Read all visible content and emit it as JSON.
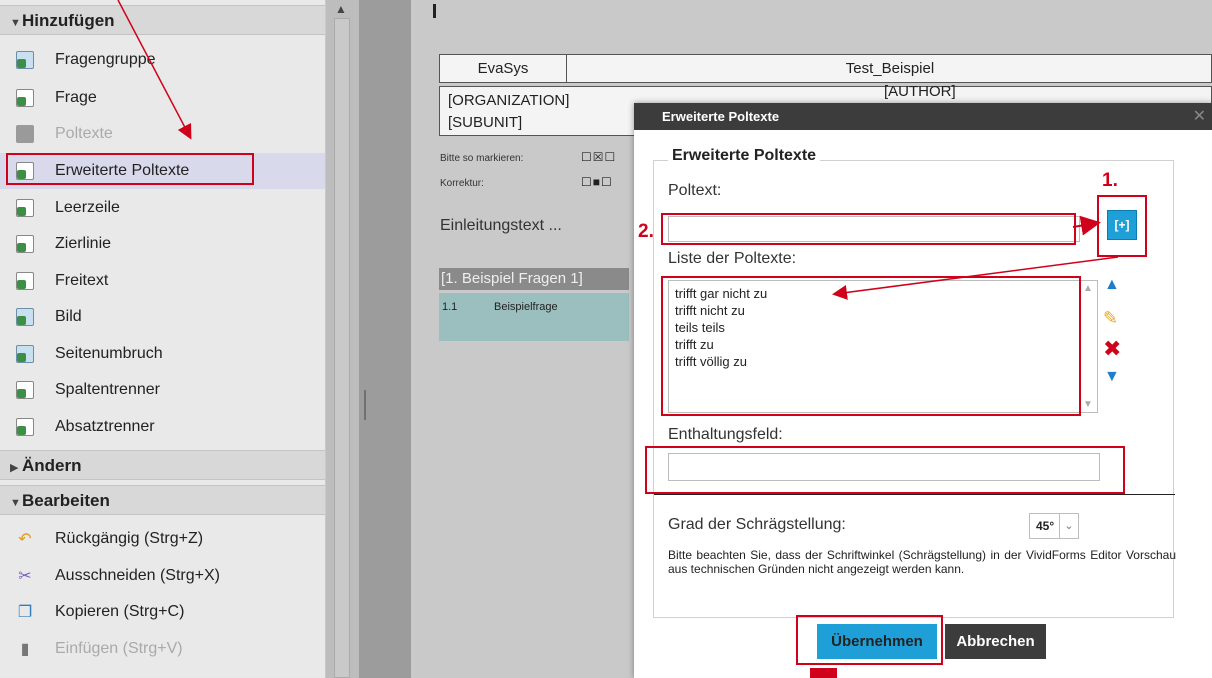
{
  "sidebar": {
    "sections": {
      "add": "Hinzufügen",
      "change": "Ändern",
      "edit": "Bearbeiten"
    },
    "add_items": [
      {
        "label": "Fragengruppe",
        "icon": "question-group-icon"
      },
      {
        "label": "Frage",
        "icon": "question-icon"
      },
      {
        "label": "Poltexte",
        "icon": "pole-text-icon",
        "disabled": true
      },
      {
        "label": "Erweiterte Poltexte",
        "icon": "extended-pole-text-icon",
        "selected": true
      },
      {
        "label": "Leerzeile",
        "icon": "blank-line-icon"
      },
      {
        "label": "Zierlinie",
        "icon": "decorative-line-icon"
      },
      {
        "label": "Freitext",
        "icon": "free-text-icon"
      },
      {
        "label": "Bild",
        "icon": "image-icon"
      },
      {
        "label": "Seitenumbruch",
        "icon": "page-break-icon"
      },
      {
        "label": "Spaltentrenner",
        "icon": "column-separator-icon"
      },
      {
        "label": "Absatztrenner",
        "icon": "paragraph-separator-icon"
      }
    ],
    "edit_items": [
      {
        "label": "Rückgängig (Strg+Z)",
        "icon": "undo-icon"
      },
      {
        "label": "Ausschneiden (Strg+X)",
        "icon": "scissors-icon"
      },
      {
        "label": "Kopieren (Strg+C)",
        "icon": "copy-icon"
      },
      {
        "label": "Einfügen (Strg+V)",
        "icon": "paste-icon",
        "disabled": true
      }
    ]
  },
  "form": {
    "header": {
      "left": "EvaSys",
      "right": "Test_Beispiel"
    },
    "org": "[ORGANIZATION]",
    "subunit": "[SUBUNIT]",
    "author": "[AUTHOR]",
    "mark_label": "Bitte so markieren:",
    "correction_label": "Korrektur:",
    "intro": "Einleitungstext ...",
    "group_title": "[1. Beispiel Fragen 1]",
    "question_num": "1.1",
    "question_text": "Beispielfrage"
  },
  "dialog": {
    "title": "Erweiterte Poltexte",
    "legend": "Erweiterte Poltexte",
    "poltext_label": "Poltext:",
    "poltext_value": "",
    "add_button": "[+]",
    "list_label": "Liste der Poltexte:",
    "list_items": [
      "trifft gar nicht zu",
      "trifft nicht zu",
      "teils teils",
      "trifft zu",
      "trifft völlig zu"
    ],
    "abstention_label": "Enthaltungsfeld:",
    "abstention_value": "",
    "angle_label": "Grad der Schrägstellung:",
    "angle_value": "45°",
    "note": "Bitte beachten Sie, dass der Schriftwinkel (Schrägstellung) in der VividForms Editor Vorschau aus technischen Gründen nicht angezeigt werden kann.",
    "ok_button": "Übernehmen",
    "cancel_button": "Abbrechen"
  },
  "annotations": {
    "step1": "1.",
    "step2": "2."
  },
  "colors": {
    "accent": "#1f9fd8",
    "highlight": "#d0021b",
    "title_bar": "#3c3c3c"
  }
}
